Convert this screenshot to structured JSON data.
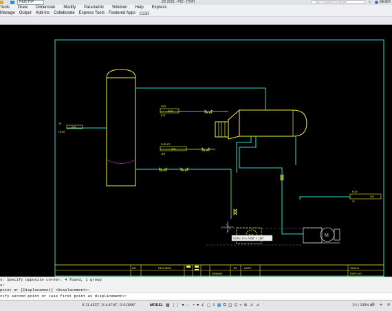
{
  "titlebar": {
    "workspace": "P&ID PIP",
    "title": "2D 2021 - PID - [?DF]",
    "search_placeholder": "Type a keyword or phrase",
    "username": "MEIER"
  },
  "menubar": {
    "items": [
      "Tools",
      "Draw",
      "Dimension",
      "Modify",
      "Parametric",
      "Window",
      "Help",
      "Express"
    ]
  },
  "ribbon_tabs": {
    "items": [
      "Manage",
      "Output",
      "Add-ins",
      "Collaborate",
      "Express Tools",
      "Featured Apps"
    ],
    "pill": "▭ ▾"
  },
  "drawing": {
    "labels": {
      "inlet_tag": "2F",
      "inlet_box": "02F",
      "inlet_sub": "HT2H",
      "ewt_tag": "EWT",
      "ewt_box": "EWT",
      "ewt_sub": "EXT",
      "fuel_tag": "FUELFS",
      "fuel_box": "1F8",
      "fuel_sub": "1F8",
      "out_tag": "PCIF",
      "out_box": "03F",
      "out_sub": "1F",
      "pump_m": "M",
      "tooltip": "Ortho: 0'-4.7450\" < 180°"
    },
    "title_block": {
      "no": "NO.",
      "revision": "REVISION",
      "by": "BY",
      "date": "DATE",
      "drawn": "DRAWN",
      "scale": "SCALE",
      "dwg_no": "DWG NO."
    },
    "colors": {
      "border": "#33dccf",
      "line_cyan": "#33dccf",
      "line_yellow": "#f2f23c",
      "line_green": "#4cd84c",
      "vessel": "#f2f23c",
      "interface": "#c43dd4"
    }
  },
  "command": {
    "history": [
      "s: Specify opposite corner: 4 found, 1 group",
      "s:",
      "point or [Displacement] <Displacement>:"
    ],
    "prompt": "cify second point or <use first point as displacement>:"
  },
  "statusbar": {
    "coords": "0'-11.4322\", 0'-4.4710\", 0'-0.0000\"",
    "model": "MODEL",
    "icons": [
      "grid-icon",
      "snap-icon",
      "infer-icon",
      "ortho-icon",
      "polar-icon",
      "isodraft-icon",
      "track-icon",
      "osnap-icon",
      "lineweight-icon",
      "transparency-icon",
      "selection-cycling-icon",
      "3dosnap-icon",
      "dynucs-icon",
      "filter-icon",
      "gizmo-icon",
      "annotation-visibility-icon",
      "autoscale-icon"
    ],
    "scale": "1:1 / 100% ▾"
  }
}
